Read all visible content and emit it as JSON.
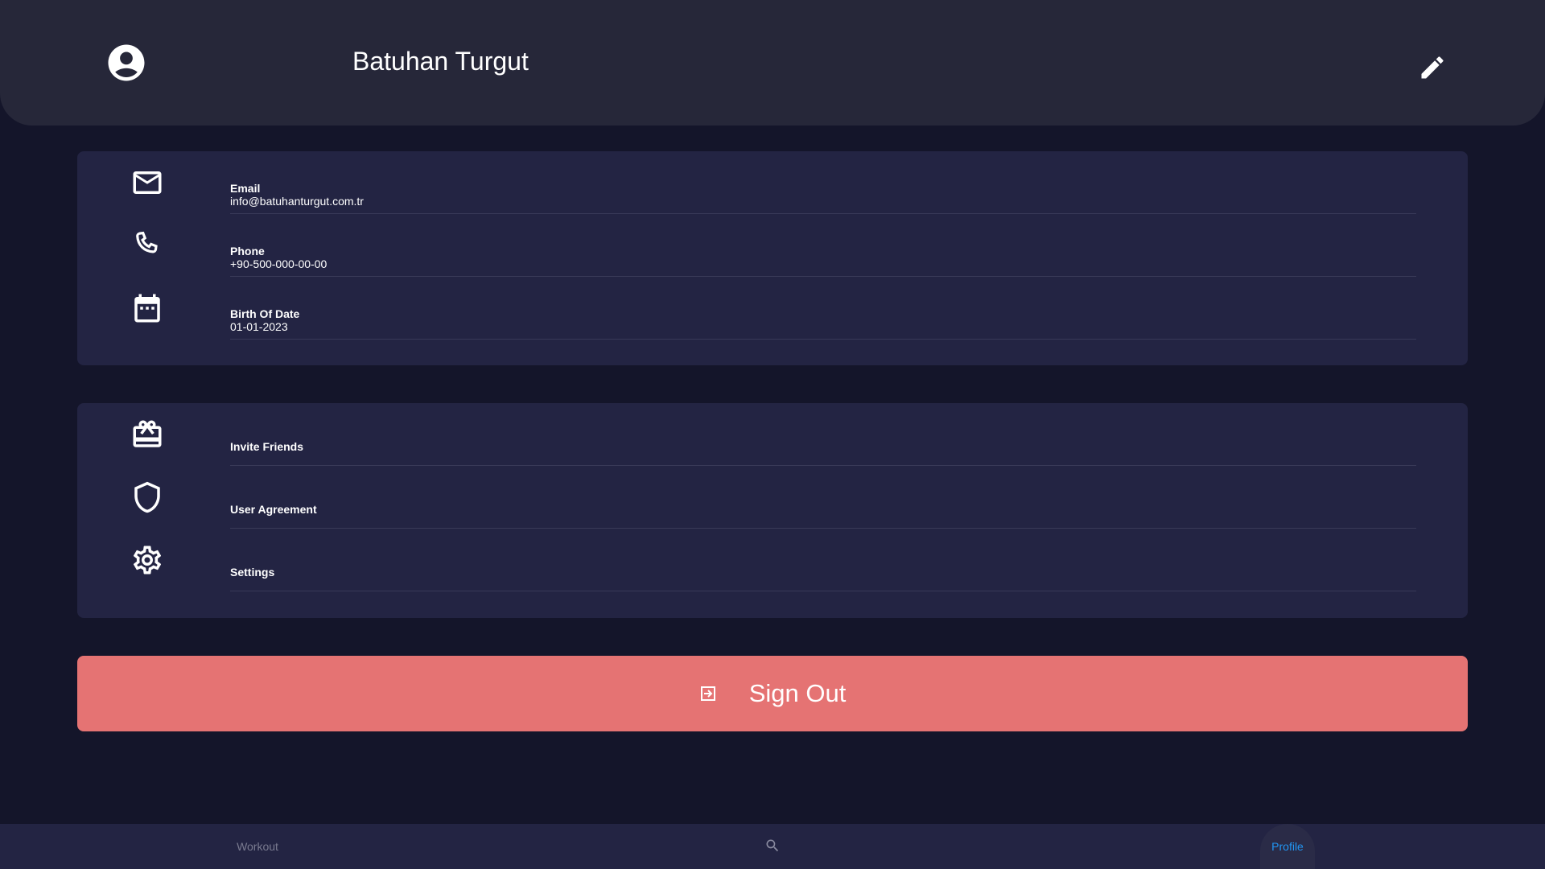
{
  "header": {
    "user_name": "Batuhan Turgut",
    "avatar_icon": "account-circle-icon",
    "edit_icon": "pencil-icon"
  },
  "info": {
    "items": [
      {
        "icon": "email-icon",
        "label": "Email",
        "value": "info@batuhanturgut.com.tr"
      },
      {
        "icon": "phone-icon",
        "label": "Phone",
        "value": "+90-500-000-00-00"
      },
      {
        "icon": "calendar-icon",
        "label": "Birth Of Date",
        "value": "01-01-2023"
      }
    ]
  },
  "menu": {
    "items": [
      {
        "icon": "gift-card-icon",
        "label": "Invite Friends"
      },
      {
        "icon": "shield-icon",
        "label": "User Agreement"
      },
      {
        "icon": "gear-icon",
        "label": "Settings"
      }
    ]
  },
  "signout": {
    "label": "Sign Out",
    "icon": "sign-out-icon",
    "color": "#e57373"
  },
  "nav": {
    "workout_label": "Workout",
    "search_icon": "search-icon",
    "profile_label": "Profile",
    "active_color": "#2196f3"
  }
}
